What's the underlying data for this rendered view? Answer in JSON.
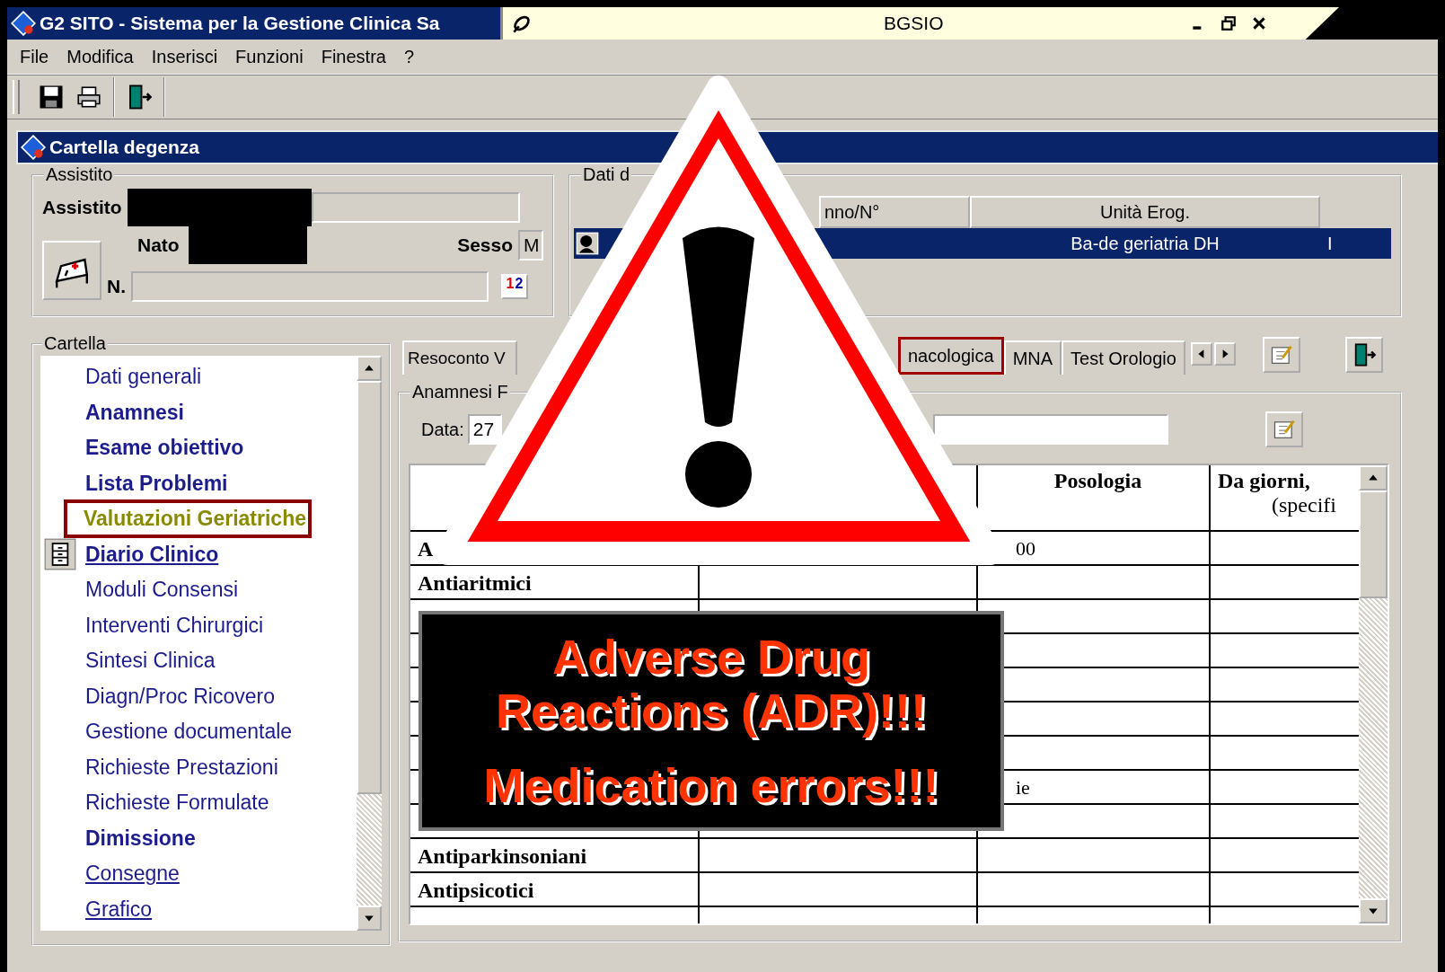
{
  "window": {
    "title": "G2 SITO - Sistema per la Gestione Clinica Sa",
    "tab_title": "BGSIO"
  },
  "menu": [
    "File",
    "Modifica",
    "Inserisci",
    "Funzioni",
    "Finestra",
    "?"
  ],
  "inner_window": {
    "title": "Cartella degenza"
  },
  "assistito": {
    "group_label": "Assistito",
    "name_label": "Assistito",
    "born_label": "Nato",
    "sex_label": "Sesso",
    "sex_value": "M",
    "number_label": "N.",
    "order_button": {
      "first": "1",
      "second": "2"
    }
  },
  "dati": {
    "group_label": "Dati d",
    "columns": [
      "nno/N°",
      "Unità Erog."
    ],
    "row": {
      "unit": "Ba-de geriatria DH",
      "column_3": "I",
      "selected": true
    }
  },
  "cartella": {
    "group_label": "Cartella",
    "items": [
      {
        "label": "Dati generali",
        "kind": "plain"
      },
      {
        "label": "Anamnesi",
        "kind": "bold"
      },
      {
        "label": "Esame obiettivo",
        "kind": "bold"
      },
      {
        "label": "Lista Problemi",
        "kind": "bold"
      },
      {
        "label": "Valutazioni Geriatriche",
        "kind": "highlighted"
      },
      {
        "label": "Diario Clinico",
        "kind": "bold-link"
      },
      {
        "label": "Moduli Consensi",
        "kind": "plain"
      },
      {
        "label": "Interventi Chirurgici",
        "kind": "plain"
      },
      {
        "label": "Sintesi Clinica",
        "kind": "plain"
      },
      {
        "label": "Diagn/Proc Ricovero",
        "kind": "plain"
      },
      {
        "label": "Gestione documentale",
        "kind": "plain"
      },
      {
        "label": "Richieste Prestazioni",
        "kind": "plain"
      },
      {
        "label": "Richieste Formulate",
        "kind": "plain"
      },
      {
        "label": "Dimissione",
        "kind": "bold"
      },
      {
        "label": "Consegne",
        "kind": "link"
      },
      {
        "label": "Grafico",
        "kind": "link"
      }
    ]
  },
  "tabs": [
    {
      "label": "Resoconto V",
      "selected": false
    },
    {
      "label": "nacologica",
      "selected": true
    },
    {
      "label": "MNA",
      "selected": false
    },
    {
      "label": "Test Orologio",
      "selected": false
    }
  ],
  "anamnesi": {
    "group_label": "Anamnesi F",
    "date_label": "Data:",
    "date_value": "27",
    "table": {
      "columns": [
        "Posologia",
        "Da giorni,"
      ],
      "column_4_note": "(specifi",
      "rows": [
        {
          "column_1": "A",
          "column_3": "00",
          "kind": "covered"
        },
        {
          "column_1": "Antiaritmici"
        },
        {},
        {},
        {},
        {},
        {},
        {
          "column_3": "ie",
          "kind": "covered"
        },
        {},
        {
          "column_1": "Antiparkinsoniani"
        },
        {
          "column_1": "Antipsicotici"
        }
      ]
    }
  },
  "alert": {
    "lines": [
      "Adverse Drug",
      "Reactions (ADR)!!!",
      "Medication errors!!!"
    ]
  }
}
